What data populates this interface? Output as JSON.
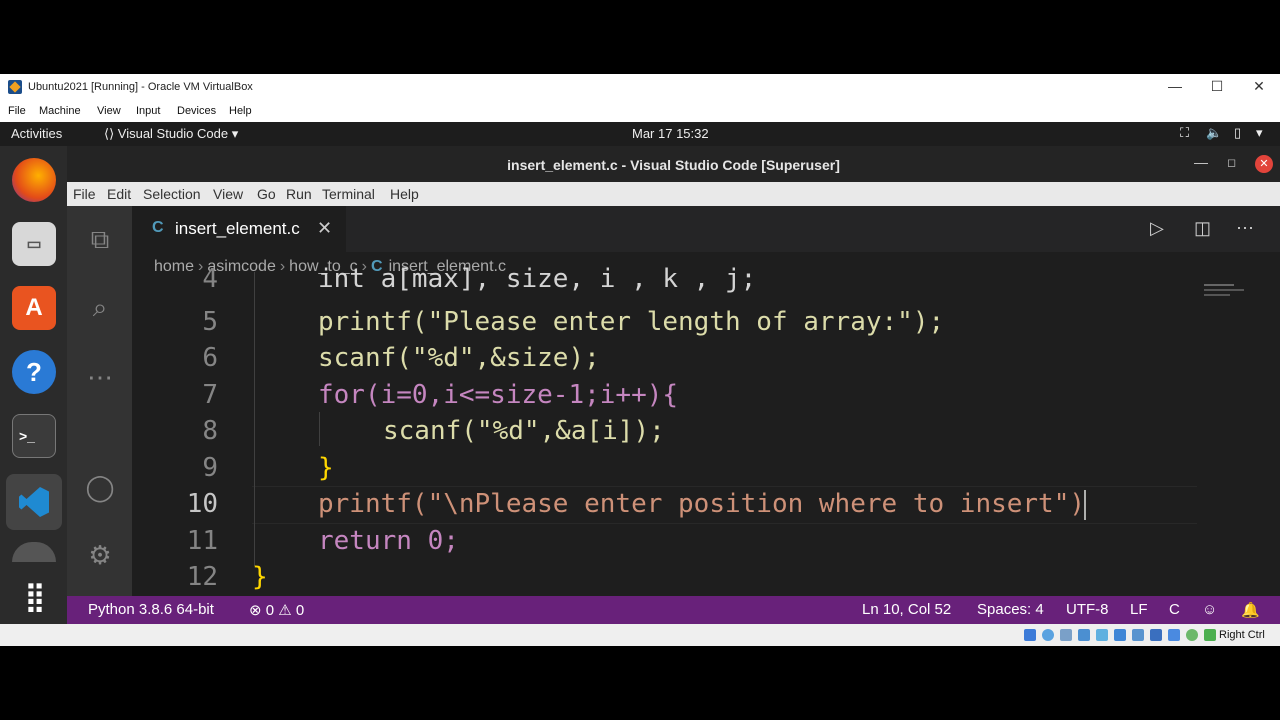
{
  "vbox": {
    "title": "Ubuntu2021 [Running] - Oracle VM VirtualBox",
    "menu": [
      "File",
      "Machine",
      "View",
      "Input",
      "Devices",
      "Help"
    ],
    "right_ctrl": "Right Ctrl"
  },
  "gnome": {
    "activities": "Activities",
    "app_menu": "Visual Studio Code ▾",
    "clock": "Mar 17  15:32"
  },
  "vscode": {
    "window_title": "insert_element.c - Visual Studio Code [Superuser]",
    "menu": [
      "File",
      "Edit",
      "Selection",
      "View",
      "Go",
      "Run",
      "Terminal",
      "Help"
    ],
    "tab": {
      "icon": "C",
      "name": "insert_element.c",
      "close": "✕"
    },
    "breadcrumb": [
      "home",
      "asimcode",
      "how_to_c",
      "insert_element.c"
    ],
    "line_numbers": [
      "4",
      "5",
      "6",
      "7",
      "8",
      "9",
      "10",
      "11",
      "12"
    ],
    "active_line": "10",
    "code": [
      "int a[max], size, i , k , j;",
      "printf(\"Please enter length of array:\");",
      "scanf(\"%d\",&size);",
      "for(i=0,i<=size-1;i++){",
      "scanf(\"%d\",&a[i]);",
      "}",
      "printf(\"\\nPlease enter position where to insert\")",
      "return 0;",
      "}"
    ],
    "status": {
      "python": "Python 3.8.6 64-bit",
      "errors": "⊗ 0 ⚠ 0",
      "position": "Ln 10, Col 52",
      "spaces": "Spaces: 4",
      "encoding": "UTF-8",
      "eol": "LF",
      "language": "C"
    }
  },
  "colors": {
    "statusbar": "#68217a",
    "editor_bg": "#1e1e1e",
    "activitybar": "#333333"
  }
}
